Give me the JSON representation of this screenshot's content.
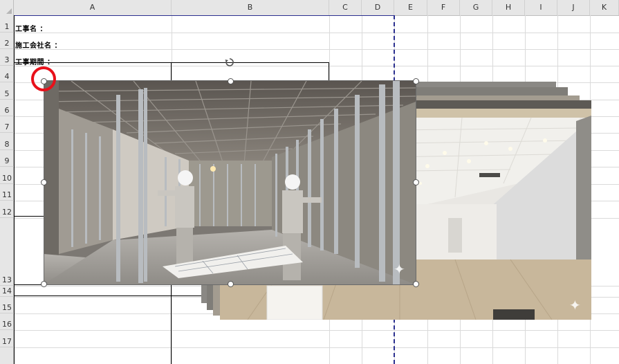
{
  "spreadsheet": {
    "columns": [
      "A",
      "B",
      "C",
      "D",
      "E",
      "F",
      "G",
      "H",
      "I",
      "J",
      "K"
    ],
    "rows": [
      "1",
      "2",
      "3",
      "4",
      "5",
      "6",
      "7",
      "8",
      "9",
      "10",
      "11",
      "12",
      "13",
      "14",
      "15",
      "16",
      "17"
    ],
    "cells": {
      "a1": "工事名 ：",
      "a2": "施工会社名 ：",
      "a3": "工事期間 ："
    }
  },
  "images": {
    "front_photo": "construction-workers-steel-stud-framing",
    "back_photo": "finished-office-interior"
  },
  "icons": {
    "rotate_handle": "rotate-icon",
    "sparkle": "sparkle-icon"
  },
  "colors": {
    "page_break": "#2a2f8f",
    "highlight_circle": "#e8101a",
    "header_bg": "#e6e6e6"
  }
}
